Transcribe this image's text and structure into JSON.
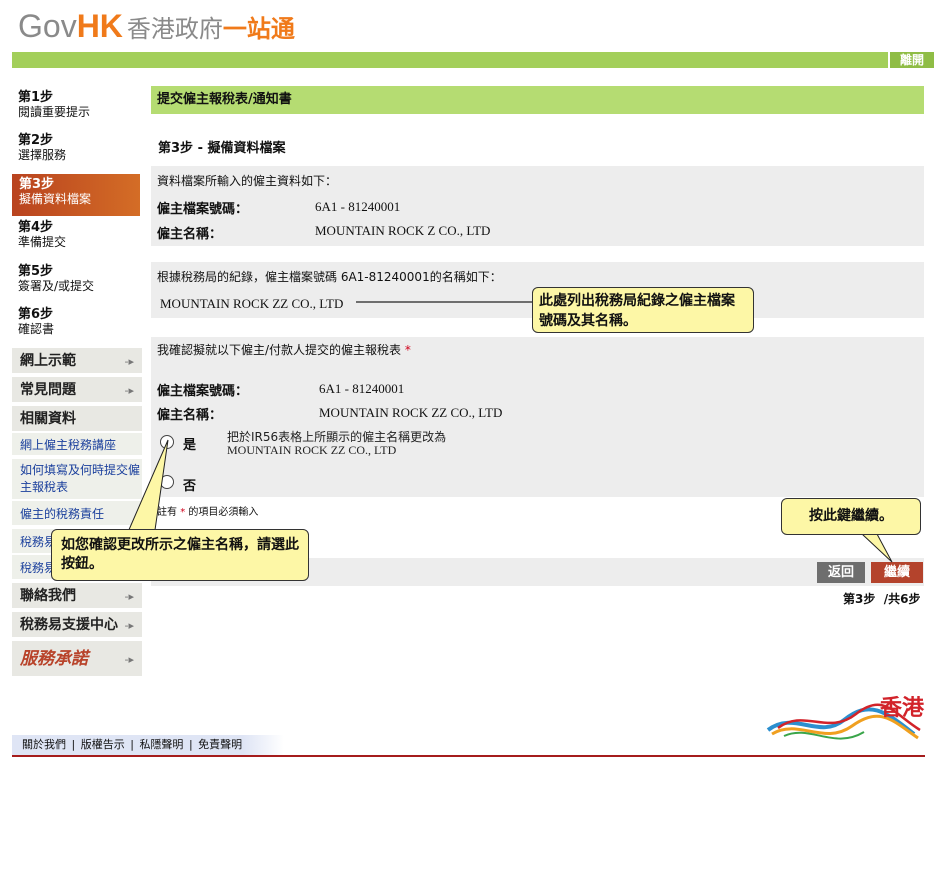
{
  "header": {
    "logo_gov": "Gov",
    "logo_hk": "HK",
    "logo_zh": "香港政府",
    "logo_zh2": "一站通",
    "logout_label": "離開"
  },
  "sidebar": {
    "steps": [
      {
        "num": "第1步",
        "label": "閱讀重要提示"
      },
      {
        "num": "第2步",
        "label": "選擇服務"
      },
      {
        "num": "第3步",
        "label": "擬備資料檔案"
      },
      {
        "num": "第4步",
        "label": "準備提交"
      },
      {
        "num": "第5步",
        "label": "簽署及/或提交"
      },
      {
        "num": "第6步",
        "label": "確認書"
      }
    ],
    "nav": {
      "demo": "網上示範",
      "faq": "常見問題",
      "related": "相關資料",
      "link1": "網上僱主稅務講座",
      "link2": "如何填寫及何時提交僱主報稅表",
      "link3": "僱主的稅務責任",
      "link4": "稅務易",
      "link5": "稅務易",
      "contact": "聯絡我們",
      "support": "稅務易支援中心",
      "pledge": "服務承諾"
    }
  },
  "main": {
    "heading": "提交僱主報稅表/通知書",
    "step_title": "第3步 - 擬備資料檔案",
    "panel1": {
      "intro": "資料檔案所輸入的僱主資料如下：",
      "file_label": "僱主檔案號碼：",
      "file_value": "6A1 - 81240001",
      "name_label": "僱主名稱：",
      "name_value": "MOUNTAIN ROCK Z CO., LTD"
    },
    "panel2": {
      "intro": "根據稅務局的紀錄，僱主檔案號碼 6A1-81240001的名稱如下：",
      "name_value": "MOUNTAIN ROCK ZZ CO., LTD"
    },
    "panel3": {
      "intro": "我確認擬就以下僱主/付款人提交的僱主報稅表",
      "required": "*",
      "file_label": "僱主檔案號碼：",
      "file_value": "6A1 - 81240001",
      "name_label": "僱主名稱：",
      "name_value": "MOUNTAIN ROCK ZZ CO., LTD",
      "yes_label": "是",
      "yes_desc_1": "把於IR56表格上所顯示的僱主名稱更改為",
      "yes_desc_2": "MOUNTAIN ROCK ZZ CO., LTD",
      "no_label": "否"
    },
    "note_prefix": "註有",
    "note_star": "*",
    "note_suffix": "的項目必須輸入",
    "back_label": "返回",
    "continue_label": "繼續",
    "step_indicator": "第3步  /共6步"
  },
  "callouts": {
    "record": "此處列出稅務局紀錄之僱主檔案號碼及其名稱。",
    "continue": "按此鍵繼續。",
    "radio": "如您確認更改所示之僱主名稱，請選此按鈕。"
  },
  "footer": {
    "about": "關於我們",
    "copyright": "版權告示",
    "privacy": "私隱聲明",
    "disclaimer": "免責聲明",
    "sep": "|",
    "brand": "香港"
  },
  "colors": {
    "green": "#a3cf5a",
    "active_step": "#c2532a",
    "callout": "#fdf7a6",
    "back_btn": "#6e6e6e",
    "continue_btn": "#b4432c"
  }
}
